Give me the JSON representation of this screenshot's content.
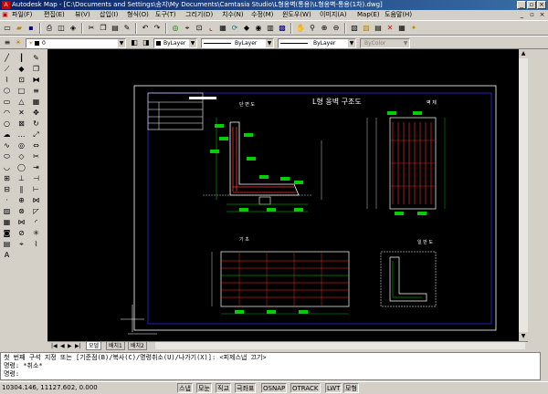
{
  "window": {
    "title": "Autodesk Map - [C:\\Documents and Settings\\송지\\My Documents\\Camtasia Studio\\L형옹벽(통용)\\L형옹벽-통용(1차).dwg]",
    "app_icon": "A",
    "min_glyph": "_",
    "max_glyph": "▫",
    "close_glyph": "×"
  },
  "menu": {
    "items": [
      "파일(F)",
      "편집(E)",
      "뷰(V)",
      "삽입(I)",
      "형식(O)",
      "도구(T)",
      "그리기(D)",
      "치수(N)",
      "수정(M)",
      "윈도우(W)",
      "이미지(A)",
      "Map(E)",
      "도움말(H)"
    ],
    "doc_icon": "▣",
    "doc_min": "_",
    "doc_restore": "▫",
    "doc_close": "×"
  },
  "properties": {
    "layer_value": "0",
    "color_value": "ByLayer",
    "linetype_value": "ByLayer",
    "lineweight_value": "ByLayer",
    "plotstyle_value": "ByColor"
  },
  "drawing": {
    "main_title": "L형 옹벽 구조도",
    "front_view": "단 면 도",
    "side_view": "벽 체",
    "plan_view": "기 초",
    "detail_view": "일 반 도"
  },
  "tabs": {
    "model": "모델",
    "layout1": "배치1",
    "layout2": "배치2",
    "nav_first": "|◀",
    "nav_prev": "◀",
    "nav_next": "▶",
    "nav_last": "▶|"
  },
  "command": {
    "line1": "첫 번째 구석 지정 또는 [기준점(B)/복사(C)/명령취소(U)/나가기(X)]:  <피제스냅 끄기>",
    "line2": "명령: *취소*",
    "line3": "명령:"
  },
  "status": {
    "coords": "10304.146, 11127.602, 0.000",
    "buttons": [
      "스냅",
      "모눈",
      "직교",
      "극좌표",
      "OSNAP",
      "OTRACK",
      "LWT",
      "모형"
    ]
  },
  "colors": {
    "canvas": "#000000",
    "rebar_red": "#ff3030",
    "dim_green": "#00d000",
    "outline_white": "#ffffff",
    "title_blue": "#0a246a"
  }
}
